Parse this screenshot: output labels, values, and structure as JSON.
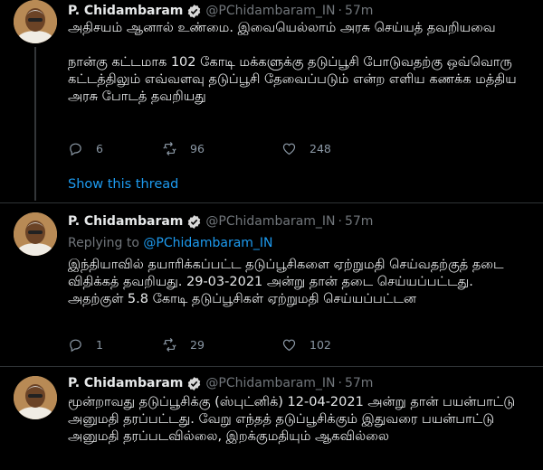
{
  "tweets": [
    {
      "author_name": "P. Chidambaram",
      "handle": "@PChidambaram_IN",
      "dot": "·",
      "time": "57m",
      "replying_label": "",
      "replying_to": "",
      "text": "அதிசயம் ஆனால் உண்மை. இவையெல்லாம் அரசு செய்யத் தவறியவை\n\nநான்கு கட்டமாக 102 கோடி மக்களுக்கு தடுப்பூசி போடுவதற்கு ஒவ்வொரு கட்டத்திலும் எவ்வளவு தடுப்பூசி தேவைப்படும் என்ற எளிய கணக்க மத்திய அரசு போடத் தவறியது",
      "replies": "6",
      "retweets": "96",
      "likes": "248"
    },
    {
      "author_name": "P. Chidambaram",
      "handle": "@PChidambaram_IN",
      "dot": "·",
      "time": "57m",
      "replying_label": "Replying to",
      "replying_to": "@PChidambaram_IN",
      "text": "இந்தியாவில் தயாரிக்கப்பட்ட தடுப்பூசிகளை ஏற்றுமதி செய்வதற்குத் தடை விதிக்கத் தவறியது. 29-03-2021 அன்று தான் தடை செய்யப்பட்டது. அதற்குள் 5.8 கோடி தடுப்பூசிகள் ஏற்றுமதி செய்யப்பட்டன",
      "replies": "1",
      "retweets": "29",
      "likes": "102"
    },
    {
      "author_name": "P. Chidambaram",
      "handle": "@PChidambaram_IN",
      "dot": "·",
      "time": "57m",
      "replying_label": "",
      "replying_to": "",
      "text": "மூன்றாவது தடுப்பூசிக்கு (ஸ்புட்னிக்) 12-04-2021 அன்று தான் பயன்பாட்டு அனுமதி தரப்பட்டது. வேறு எந்தத் தடுப்பூசிக்கும் இதுவரை பயன்பாட்டு அனுமதி தரப்படவில்லை, இறக்குமதியும் ஆகவில்லை",
      "replies": "",
      "retweets": "",
      "likes": ""
    }
  ],
  "show_thread_label": "Show this thread",
  "colors": {
    "background": "#000000",
    "link": "#1d9bf0",
    "verified": "#1d9bf0",
    "muted": "#71767b",
    "text": "#e7e9ea"
  },
  "icons": [
    "reply-icon",
    "retweet-icon",
    "like-icon",
    "verified-badge-icon"
  ]
}
